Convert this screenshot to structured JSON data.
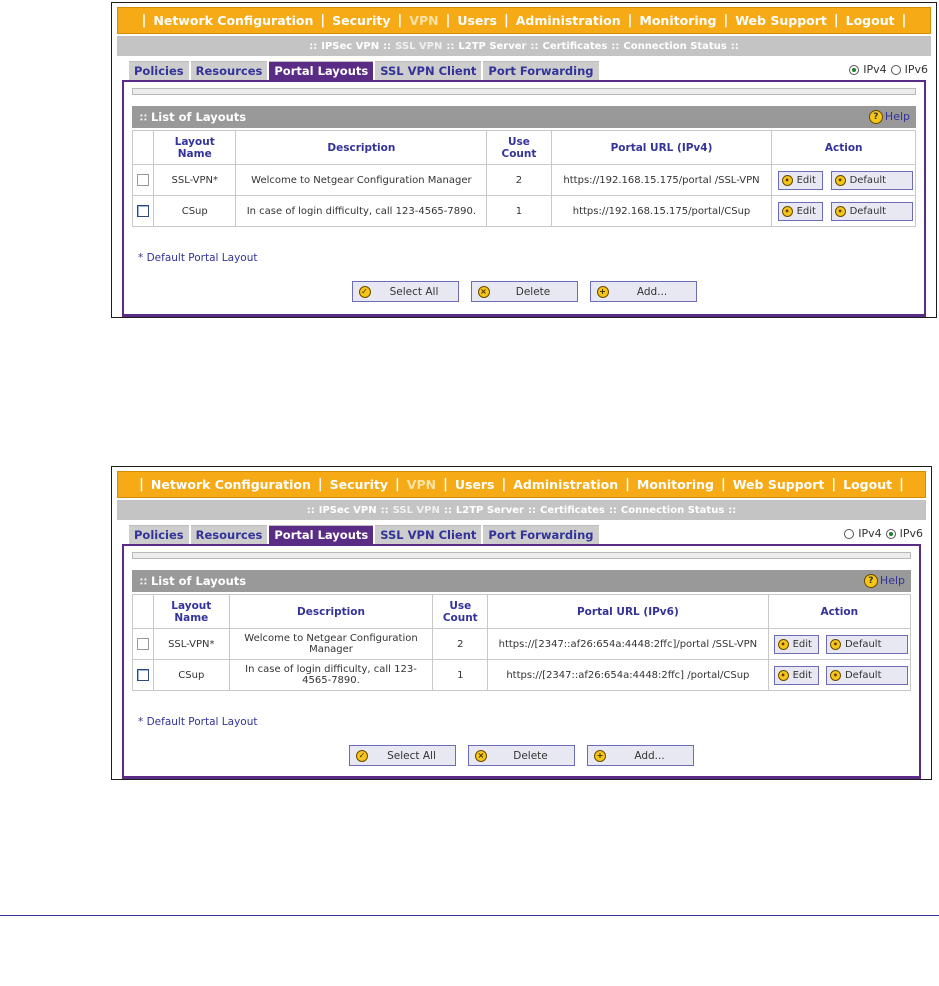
{
  "nav": {
    "items": [
      "Network Configuration",
      "Security",
      "VPN",
      "Users",
      "Administration",
      "Monitoring",
      "Web Support",
      "Logout"
    ],
    "active": "VPN"
  },
  "subnav": {
    "items": [
      "IPSec VPN",
      "SSL VPN",
      "L2TP Server",
      "Certificates",
      "Connection Status"
    ],
    "active": "SSL VPN"
  },
  "tabs": [
    "Policies",
    "Resources",
    "Portal Layouts",
    "SSL VPN Client",
    "Port Forwarding"
  ],
  "active_tab": "Portal Layouts",
  "radio_ipv4": "IPv4",
  "radio_ipv6": "IPv6",
  "section_title": "List of Layouts",
  "help_label": "Help",
  "footnote": "* Default Portal Layout",
  "buttons": {
    "select_all": "Select All",
    "delete": "Delete",
    "add": "Add..."
  },
  "columns": {
    "layout_name": "Layout Name",
    "description": "Description",
    "use_count": "Use Count",
    "action": "Action"
  },
  "actions": {
    "edit": "Edit",
    "default": "Default"
  },
  "screen1": {
    "selected_ip": "IPv4",
    "url_header": "Portal URL (IPv4)",
    "rows": [
      {
        "name": "SSL-VPN*",
        "description": "Welcome to Netgear Configuration Manager",
        "use_count": "2",
        "url": "https://192.168.15.175/portal /SSL-VPN",
        "checkbox_enabled": false
      },
      {
        "name": "CSup",
        "description": "In case of login difficulty, call 123-4565-7890.",
        "use_count": "1",
        "url": "https://192.168.15.175/portal/CSup",
        "checkbox_enabled": true
      }
    ]
  },
  "screen2": {
    "selected_ip": "IPv6",
    "url_header": "Portal URL (IPv6)",
    "rows": [
      {
        "name": "SSL-VPN*",
        "description": "Welcome to Netgear Configuration Manager",
        "use_count": "2",
        "url": "https://[2347::af26:654a:4448:2ffc]/portal /SSL-VPN",
        "checkbox_enabled": false
      },
      {
        "name": "CSup",
        "description": "In case of login difficulty, call 123-4565-7890.",
        "use_count": "1",
        "url": "https://[2347::af26:654a:4448:2ffc] /portal/CSup",
        "checkbox_enabled": true
      }
    ]
  },
  "colors": {
    "nav_orange": "#f5aa16",
    "tab_purple": "#5b2c86",
    "header_gray": "#999999",
    "link_blue": "#333399"
  }
}
